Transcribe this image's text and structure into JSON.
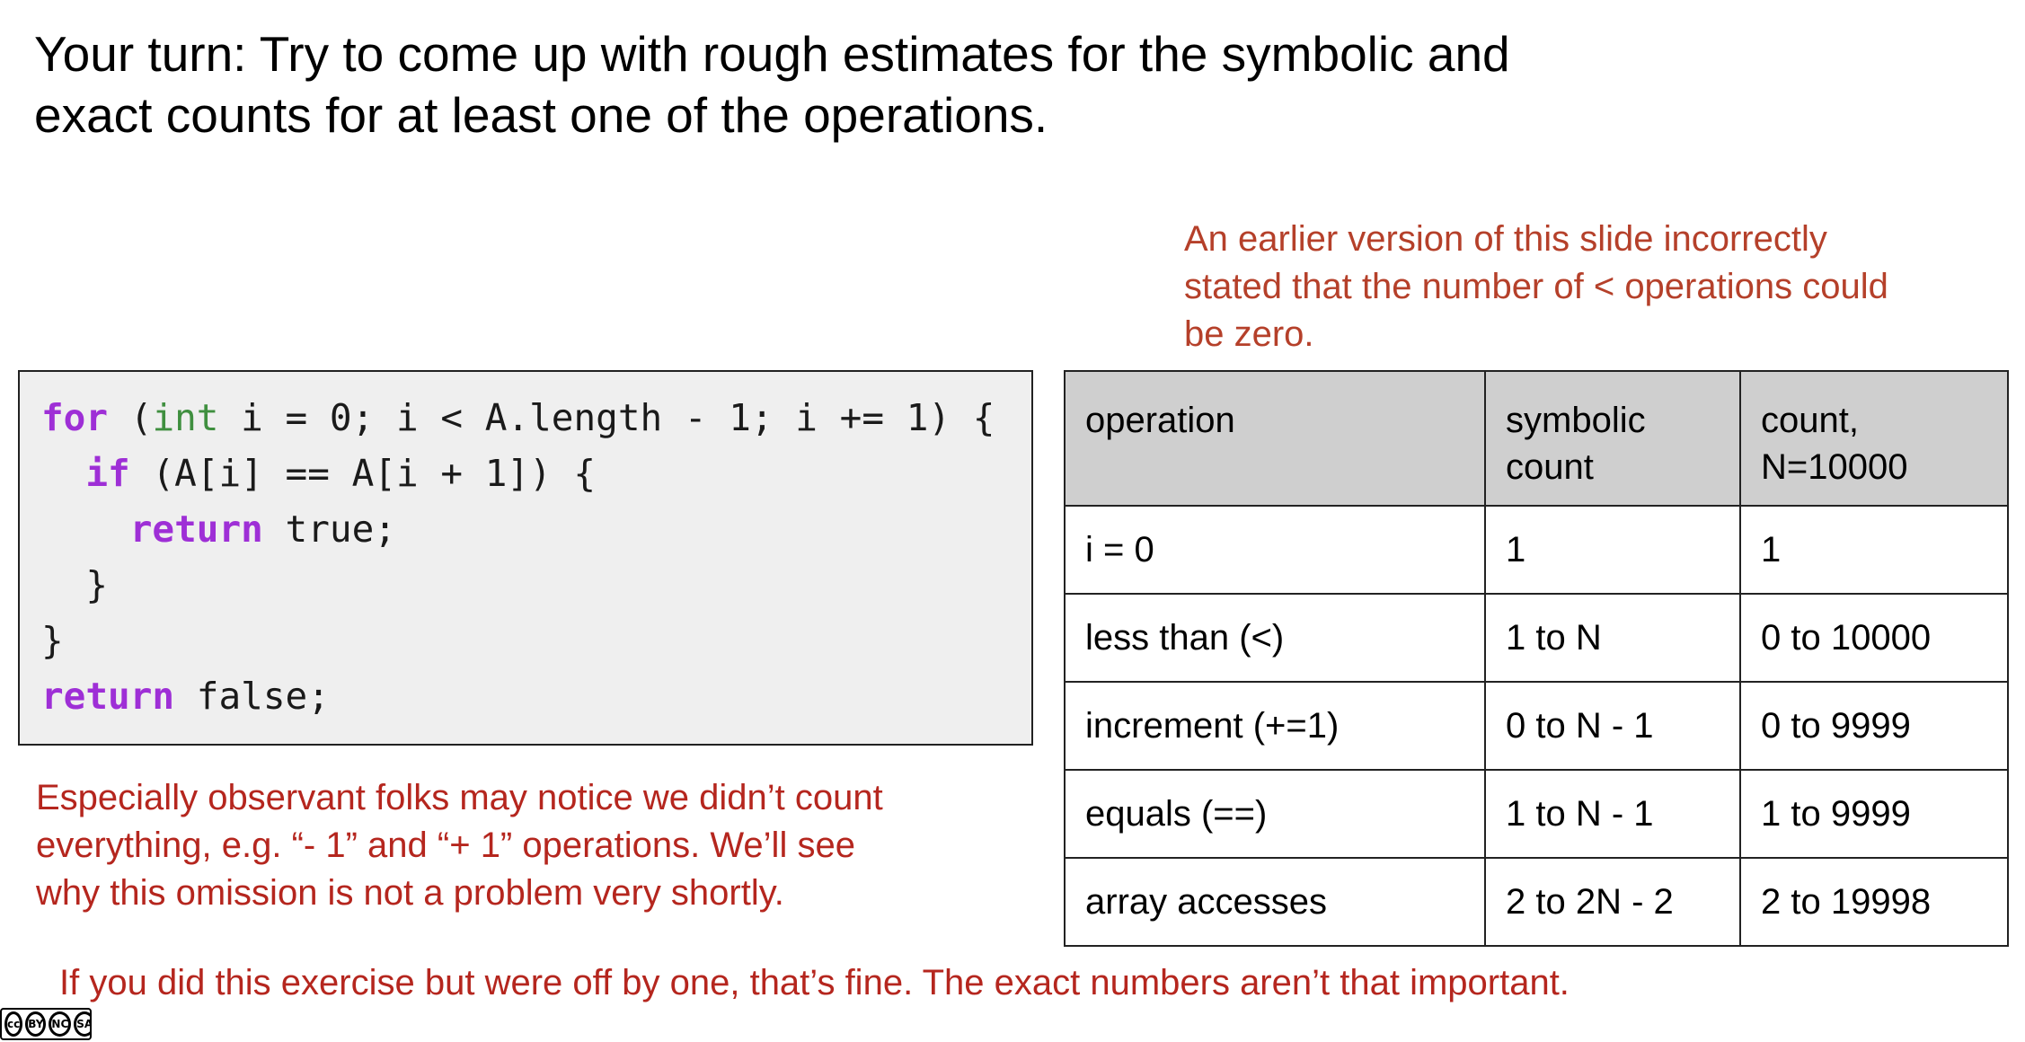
{
  "title": {
    "line1": "Your turn: Try to come up with rough estimates for the symbolic and",
    "line2": "exact counts for at least one of the operations."
  },
  "note_top": {
    "line1": "An earlier version of this slide incorrectly",
    "line2": "stated that the number of < operations could",
    "line3": "be zero."
  },
  "code": {
    "l1_for": "for",
    "l1_a": " (",
    "l1_int": "int",
    "l1_b": " i = 0; i < A.length - 1; i += 1) {",
    "l2_indent": "  ",
    "l2_if": "if",
    "l2_b": " (A[i] == A[i + 1]) {",
    "l3_indent": "    ",
    "l3_return": "return",
    "l3_b": " true;",
    "l4": "  }",
    "l5": "}",
    "l6_return": "return",
    "l6_b": " false;"
  },
  "note_bottom": {
    "line1": "Especially observant folks may notice we didn’t count",
    "line2": "everything, e.g. “- 1” and “+ 1” operations. We’ll see",
    "line3": "why this omission is not a problem very shortly."
  },
  "table": {
    "headers": {
      "operation": "operation",
      "symbolic_1": "symbolic",
      "symbolic_2": "count",
      "count_1": "count,",
      "count_2": "N=10000"
    },
    "rows": [
      {
        "operation": "i = 0",
        "symbolic": "1",
        "count": "1"
      },
      {
        "operation": "less than (<)",
        "symbolic": "1 to N",
        "count": "0 to 10000"
      },
      {
        "operation": "increment (+=1)",
        "symbolic": "0 to N - 1",
        "count": "0 to 9999"
      },
      {
        "operation": "equals (==)",
        "symbolic": "1 to N - 1",
        "count": "1 to 9999"
      },
      {
        "operation": "array accesses",
        "symbolic": "2 to 2N - 2",
        "count": "2 to 19998"
      }
    ]
  },
  "footer_note": "If you did this exercise but were off by one, that’s fine. The exact numbers aren’t that important.",
  "license_icon": "creative-commons-by-nc-sa-icon",
  "license": {
    "cc": "cc",
    "by": "BY",
    "nc": "NC",
    "sa": "SA"
  },
  "colors": {
    "note_text": "#b5261e",
    "keyword": "#9e2fd6",
    "type_keyword": "#3f8f3f",
    "header_bg": "#cfcfcf",
    "code_bg": "#efefef"
  }
}
